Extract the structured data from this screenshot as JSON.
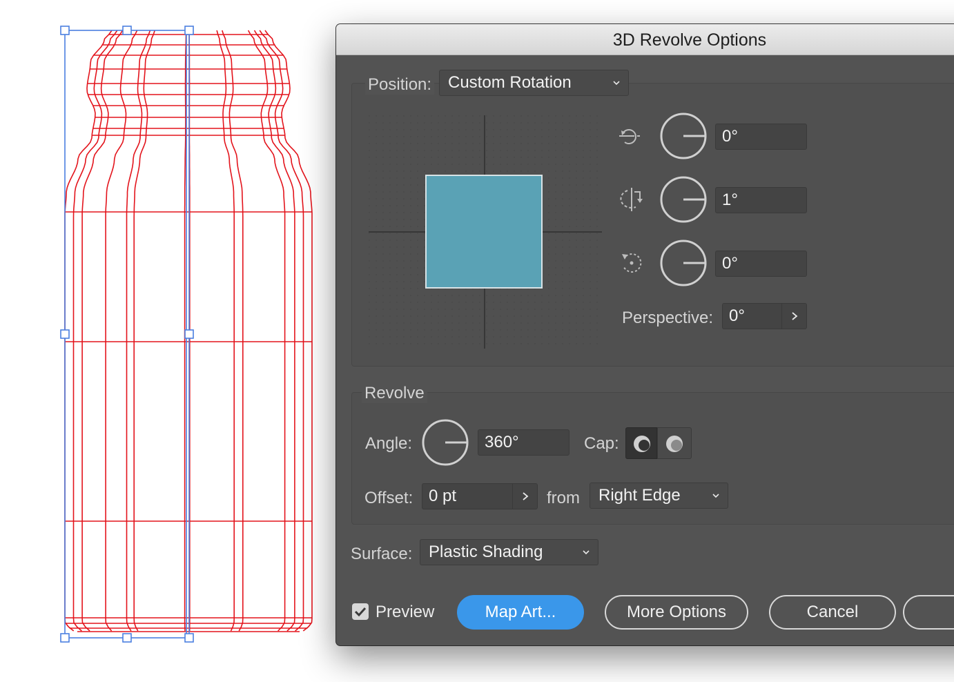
{
  "dialog": {
    "title": "3D Revolve Options",
    "position": {
      "label": "Position:",
      "selected": "Custom Rotation",
      "rotation_x": "0°",
      "rotation_y": "1°",
      "rotation_z": "0°",
      "perspective_label": "Perspective:",
      "perspective_value": "0°",
      "preview_cube_color": "#5aa2b5"
    },
    "revolve": {
      "heading": "Revolve",
      "angle_label": "Angle:",
      "angle_value": "360°",
      "cap_label": "Cap:",
      "offset_label": "Offset:",
      "offset_value": "0 pt",
      "from_label": "from",
      "from_selected": "Right Edge"
    },
    "surface": {
      "label": "Surface:",
      "selected": "Plastic Shading"
    },
    "preview": {
      "label": "Preview",
      "checked": true
    },
    "buttons": {
      "map_art": "Map Art...",
      "more_options": "More Options",
      "cancel": "Cancel"
    }
  },
  "icons": {
    "x_axis": "rotate-x-icon",
    "y_axis": "rotate-y-icon",
    "z_axis": "rotate-z-icon",
    "cap_on": "cap-on-icon",
    "cap_off": "cap-off-icon",
    "dropdown": "chevron-down-icon",
    "stepper": "chevron-right-icon",
    "checkbox": "checkmark-icon"
  },
  "colors": {
    "wireframe": "#e3131b",
    "selection": "#4a7fe0",
    "accent": "#3a97ea",
    "dialog_bg": "#535353"
  }
}
